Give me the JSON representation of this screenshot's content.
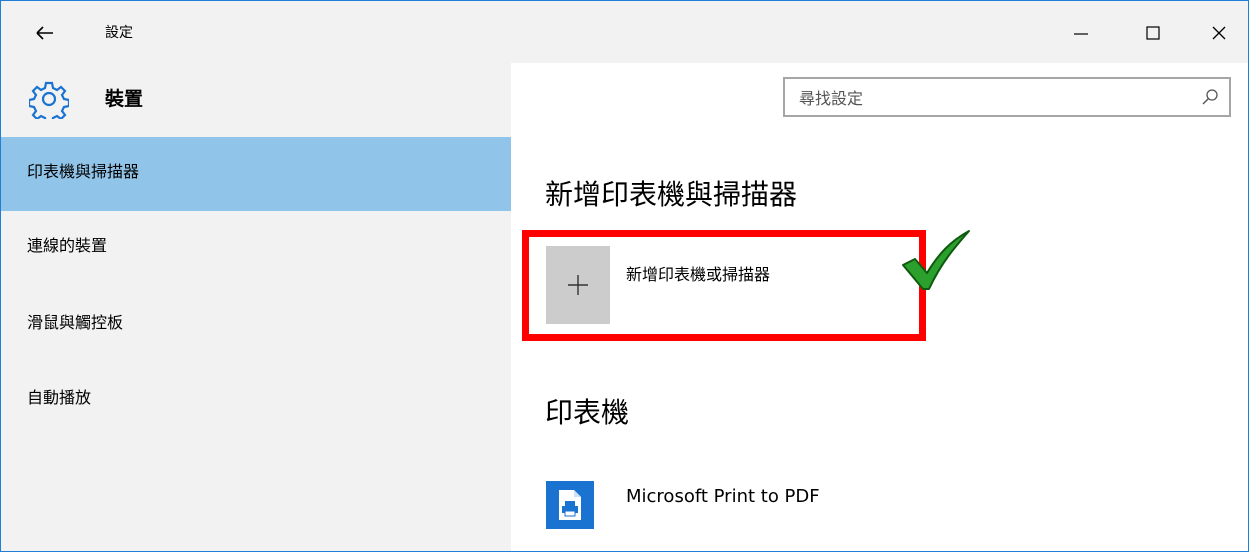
{
  "window": {
    "title": "設定",
    "controls": {
      "minimize": "minimize-icon",
      "maximize": "maximize-icon",
      "close": "close-icon"
    }
  },
  "header": {
    "section_icon": "gear-icon",
    "section_title": "裝置",
    "search": {
      "placeholder": "尋找設定",
      "icon": "search-icon"
    }
  },
  "sidebar": {
    "items": [
      {
        "label": "印表機與掃描器",
        "selected": true
      },
      {
        "label": "連線的裝置",
        "selected": false
      },
      {
        "label": "滑鼠與觸控板",
        "selected": false
      },
      {
        "label": "自動播放",
        "selected": false
      }
    ]
  },
  "main": {
    "add_section": {
      "heading": "新增印表機與掃描器",
      "add_button_label": "新增印表機或掃描器",
      "add_icon": "plus-icon",
      "annotation": "check-mark-icon"
    },
    "printers_section": {
      "heading": "印表機",
      "printers": [
        {
          "name": "Microsoft Print to PDF",
          "icon": "pdf-printer-icon"
        }
      ]
    }
  },
  "colors": {
    "sidebar_bg": "#f2f2f2",
    "selected_bg": "#91c4e9",
    "accent_blue": "#1a73d1",
    "window_border": "#1e7fd4",
    "highlight_red": "#ff0000",
    "check_green": "#2ca02c",
    "tile_gray": "#cccccc"
  }
}
